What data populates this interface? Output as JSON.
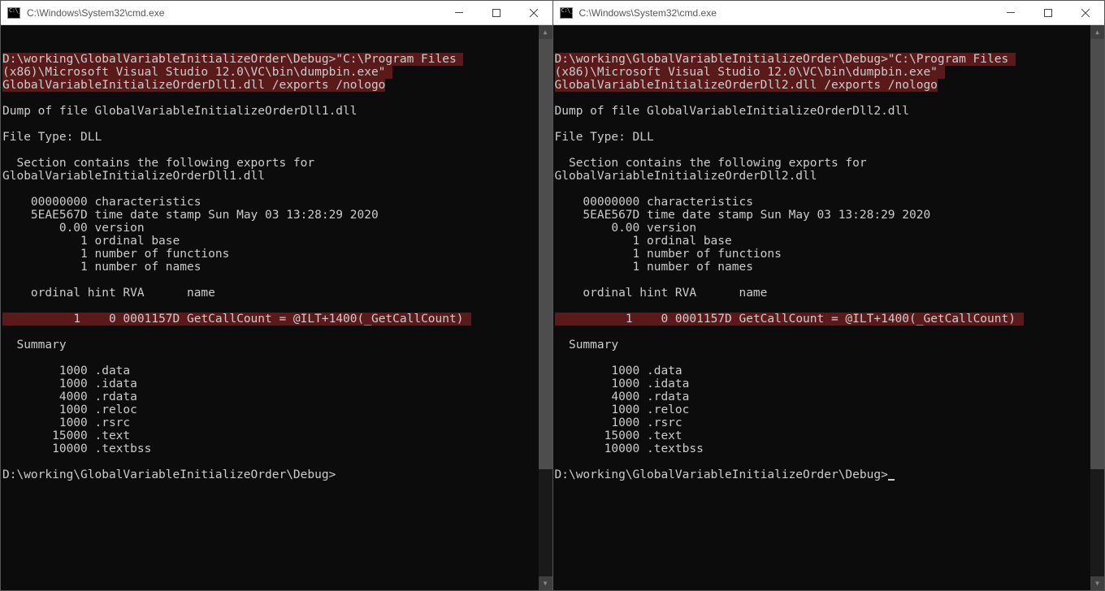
{
  "left": {
    "title": "C:\\Windows\\System32\\cmd.exe",
    "cmd": "D:\\working\\GlobalVariableInitializeOrder\\Debug>\"C:\\Program Files (x86)\\Microsoft Visual Studio 12.0\\VC\\bin\\dumpbin.exe\" GlobalVariableInitializeOrderDll1.dll /exports /nologo",
    "blank1": "",
    "dumpof": "Dump of file GlobalVariableInitializeOrderDll1.dll",
    "filetype": "File Type: DLL",
    "section": "  Section contains the following exports for GlobalVariableInitializeOrderDll1.dll",
    "char": "    00000000 characteristics",
    "timestamp": "    5EAE567D time date stamp Sun May 03 13:28:29 2020",
    "version": "        0.00 version",
    "ordbase": "           1 ordinal base",
    "nfunc": "           1 number of functions",
    "nnames": "           1 number of names",
    "ordhint": "    ordinal hint RVA      name",
    "exportrow": "          1    0 0001157D GetCallCount = @ILT+1400(_GetCallCount)",
    "summary": "  Summary",
    "s1": "        1000 .data",
    "s2": "        1000 .idata",
    "s3": "        4000 .rdata",
    "s4": "        1000 .reloc",
    "s5": "        1000 .rsrc",
    "s6": "       15000 .text",
    "s7": "       10000 .textbss",
    "prompt2": "D:\\working\\GlobalVariableInitializeOrder\\Debug>"
  },
  "right": {
    "title": "C:\\Windows\\System32\\cmd.exe",
    "cmd": "D:\\working\\GlobalVariableInitializeOrder\\Debug>\"C:\\Program Files (x86)\\Microsoft Visual Studio 12.0\\VC\\bin\\dumpbin.exe\" GlobalVariableInitializeOrderDll2.dll /exports /nologo",
    "blank1": "",
    "dumpof": "Dump of file GlobalVariableInitializeOrderDll2.dll",
    "filetype": "File Type: DLL",
    "section": "  Section contains the following exports for GlobalVariableInitializeOrderDll2.dll",
    "char": "    00000000 characteristics",
    "timestamp": "    5EAE567D time date stamp Sun May 03 13:28:29 2020",
    "version": "        0.00 version",
    "ordbase": "           1 ordinal base",
    "nfunc": "           1 number of functions",
    "nnames": "           1 number of names",
    "ordhint": "    ordinal hint RVA      name",
    "exportrow": "          1    0 0001157D GetCallCount = @ILT+1400(_GetCallCount)",
    "summary": "  Summary",
    "s1": "        1000 .data",
    "s2": "        1000 .idata",
    "s3": "        4000 .rdata",
    "s4": "        1000 .reloc",
    "s5": "        1000 .rsrc",
    "s6": "       15000 .text",
    "s7": "       10000 .textbss",
    "prompt2": "D:\\working\\GlobalVariableInitializeOrder\\Debug>"
  }
}
